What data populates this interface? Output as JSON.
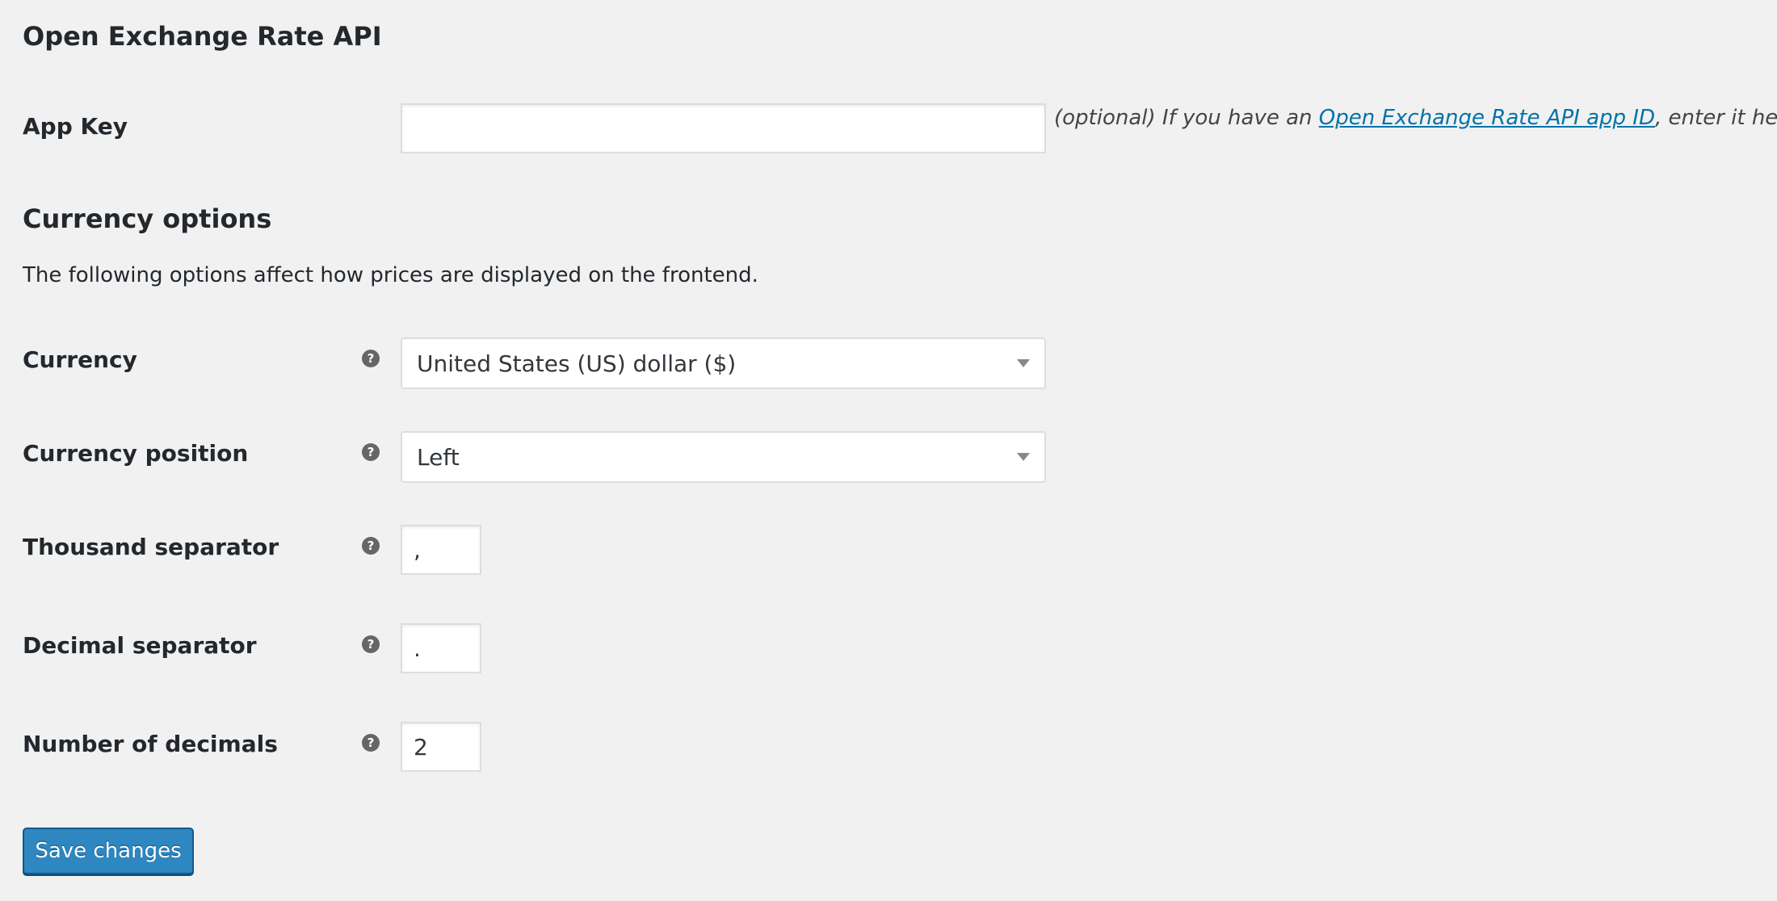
{
  "api_section": {
    "title": "Open Exchange Rate API",
    "app_key": {
      "label": "App Key",
      "value": "",
      "description_prefix": "(optional) If you have an ",
      "description_link": "Open Exchange Rate API app ID",
      "description_suffix": ", enter it here."
    }
  },
  "currency_section": {
    "title": "Currency options",
    "intro": "The following options affect how prices are displayed on the frontend.",
    "currency": {
      "label": "Currency",
      "selected": "United States (US) dollar ($)"
    },
    "currency_position": {
      "label": "Currency position",
      "selected": "Left"
    },
    "thousand_separator": {
      "label": "Thousand separator",
      "value": ","
    },
    "decimal_separator": {
      "label": "Decimal separator",
      "value": "."
    },
    "number_of_decimals": {
      "label": "Number of decimals",
      "value": "2"
    },
    "help_icon_glyph": "?"
  },
  "actions": {
    "save_label": "Save changes"
  },
  "colors": {
    "background": "#f1f1f1",
    "link": "#0073aa",
    "primary_button": "#2e87c0"
  },
  "icons": {
    "help": "question-circle-icon",
    "dropdown": "chevron-down-icon"
  }
}
